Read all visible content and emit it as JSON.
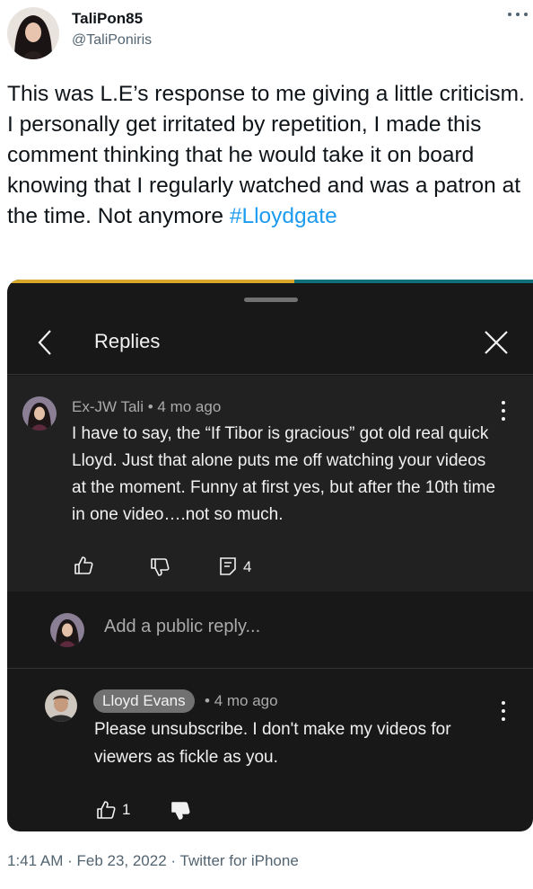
{
  "tweet": {
    "display_name": "TaliPon85",
    "handle": "@TaliPoniris",
    "text": "This was L.E’s response to me giving a little criticism. I personally get irritated by repetition, I made this comment thinking that he would take it on board knowing that I regularly watched and was a patron at the time. Not anymore ",
    "hashtag": "#Lloydgate",
    "time": "1:41 AM",
    "separator": " · ",
    "date": "Feb 23, 2022",
    "source": "Twitter for iPhone"
  },
  "screenshot": {
    "header_title": "Replies",
    "comment": {
      "author": "Ex-JW Tali",
      "bullet": "•",
      "time": "4 mo ago",
      "text": "I have to say, the “If Tibor is gracious” got old real quick Lloyd. Just that alone puts me off watching your videos at the moment. Funny at first yes, but after the 10th time in one video….not so much.",
      "reply_count": "4"
    },
    "reply_input_placeholder": "Add a public reply...",
    "reply": {
      "author": "Lloyd Evans",
      "bullet": "•",
      "time": "4 mo ago",
      "text": "Please unsubscribe. I don't make my videos for viewers as fickle as you.",
      "like_count": "1"
    }
  },
  "icons": {
    "more": "more-horizontal-icon",
    "back": "chevron-left-icon",
    "close": "close-icon",
    "comment_menu": "more-vertical-icon",
    "like": "thumbs-up-icon",
    "dislike": "thumbs-down-icon",
    "replies": "reply-icon"
  },
  "colors": {
    "hashtag": "#1d9bf0",
    "dark_bg": "#181818",
    "comment_bg": "#212121",
    "muted": "#536471"
  }
}
